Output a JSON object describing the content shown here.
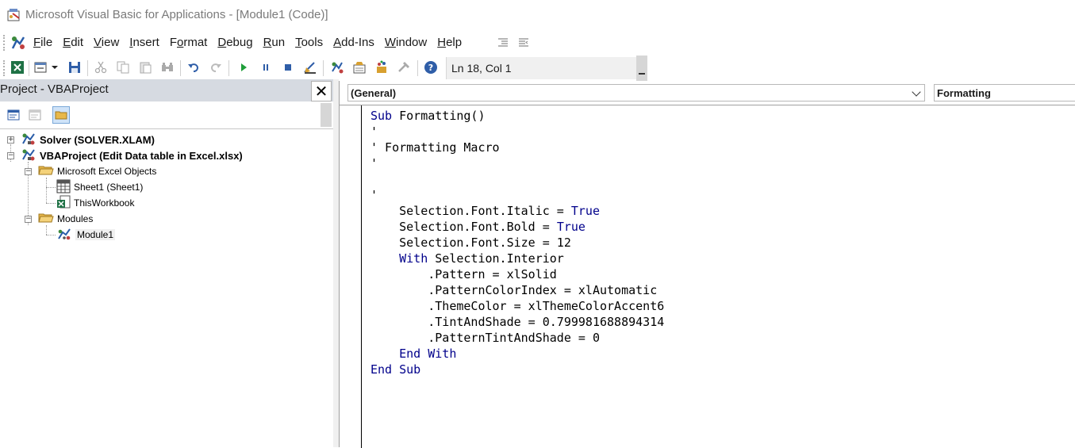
{
  "window": {
    "title": "Microsoft Visual Basic for Applications - [Module1 (Code)]"
  },
  "menu": {
    "items": [
      {
        "pre": "",
        "ul": "F",
        "post": "ile"
      },
      {
        "pre": "",
        "ul": "E",
        "post": "dit"
      },
      {
        "pre": "",
        "ul": "V",
        "post": "iew"
      },
      {
        "pre": "",
        "ul": "I",
        "post": "nsert"
      },
      {
        "pre": "F",
        "ul": "o",
        "post": "rmat"
      },
      {
        "pre": "",
        "ul": "D",
        "post": "ebug"
      },
      {
        "pre": "",
        "ul": "R",
        "post": "un"
      },
      {
        "pre": "",
        "ul": "T",
        "post": "ools"
      },
      {
        "pre": "",
        "ul": "A",
        "post": "dd-Ins"
      },
      {
        "pre": "",
        "ul": "W",
        "post": "indow"
      },
      {
        "pre": "",
        "ul": "H",
        "post": "elp"
      }
    ]
  },
  "toolbar": {
    "status": "Ln 18, Col 1"
  },
  "project": {
    "title": "Project - VBAProject",
    "close_glyph": "✕",
    "nodes": {
      "solver": "Solver (SOLVER.XLAM)",
      "vbaproject": "VBAProject (Edit Data table in Excel.xlsx)",
      "excel_objects": "Microsoft Excel Objects",
      "sheet1": "Sheet1 (Sheet1)",
      "thisworkbook": "ThisWorkbook",
      "modules": "Modules",
      "module1": "Module1"
    }
  },
  "code": {
    "object_dropdown": "(General)",
    "procedure_dropdown": "Formatting",
    "lines": [
      [
        {
          "kw": true,
          "t": "Sub"
        },
        {
          "kw": false,
          "t": " Formatting()"
        }
      ],
      [
        {
          "kw": false,
          "t": "'"
        }
      ],
      [
        {
          "kw": false,
          "t": "' Formatting Macro"
        }
      ],
      [
        {
          "kw": false,
          "t": "'"
        }
      ],
      [
        {
          "kw": false,
          "t": ""
        }
      ],
      [
        {
          "kw": false,
          "t": "'"
        }
      ],
      [
        {
          "kw": false,
          "t": "    Selection.Font.Italic = "
        },
        {
          "kw": true,
          "t": "True"
        }
      ],
      [
        {
          "kw": false,
          "t": "    Selection.Font.Bold = "
        },
        {
          "kw": true,
          "t": "True"
        }
      ],
      [
        {
          "kw": false,
          "t": "    Selection.Font.Size = 12"
        }
      ],
      [
        {
          "kw": false,
          "t": "    "
        },
        {
          "kw": true,
          "t": "With"
        },
        {
          "kw": false,
          "t": " Selection.Interior"
        }
      ],
      [
        {
          "kw": false,
          "t": "        .Pattern = xlSolid"
        }
      ],
      [
        {
          "kw": false,
          "t": "        .PatternColorIndex = xlAutomatic"
        }
      ],
      [
        {
          "kw": false,
          "t": "        .ThemeColor = xlThemeColorAccent6"
        }
      ],
      [
        {
          "kw": false,
          "t": "        .TintAndShade = 0.799981688894314"
        }
      ],
      [
        {
          "kw": false,
          "t": "        .PatternTintAndShade = 0"
        }
      ],
      [
        {
          "kw": false,
          "t": "    "
        },
        {
          "kw": true,
          "t": "End With"
        }
      ],
      [
        {
          "kw": true,
          "t": "End Sub"
        }
      ]
    ]
  },
  "colors": {
    "keyword": "#00008b",
    "panel_header": "#d6dae1"
  }
}
